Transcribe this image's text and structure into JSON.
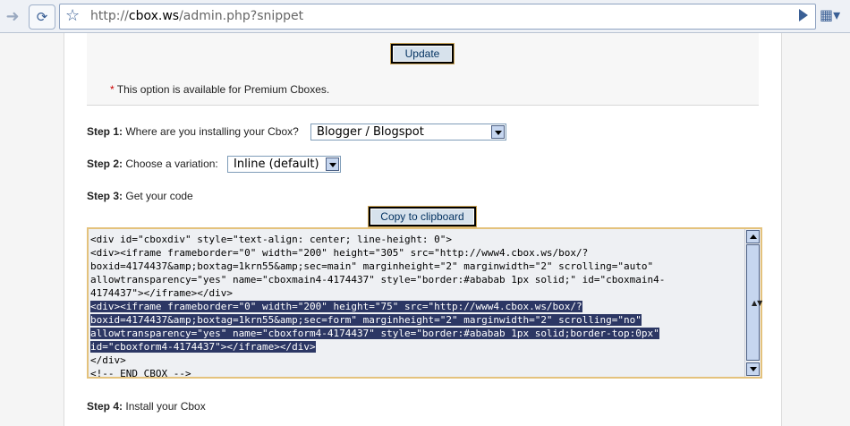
{
  "browser": {
    "back_icon": "arrow-right-icon",
    "reload_icon": "refresh-icon",
    "bookmark_icon": "star-icon",
    "url_prefix": "http://",
    "url_host": "cbox.ws",
    "url_path": "/admin.php?snippet",
    "page_icon": "page-icon"
  },
  "options": {
    "update_label": "Update",
    "premium_marker": "*",
    "premium_note": "This option is available for Premium Cboxes."
  },
  "steps": {
    "step1_label": "Step 1:",
    "step1_text": "Where are you installing your Cbox?",
    "step1_value": "Blogger / Blogspot",
    "step2_label": "Step 2:",
    "step2_text": "Choose a variation:",
    "step2_value": "Inline (default)",
    "step3_label": "Step 3:",
    "step3_text": "Get your code",
    "copy_label": "Copy to clipboard",
    "step4_label": "Step 4:",
    "step4_text": "Install your Cbox"
  },
  "code_lines": [
    "<div id=\"cboxdiv\" style=\"text-align: center; line-height: 0\">",
    "<div><iframe frameborder=\"0\" width=\"200\" height=\"305\" src=\"http://www4.cbox.ws/box/?",
    "boxid=4174437&amp;boxtag=1krn55&amp;sec=main\" marginheight=\"2\" marginwidth=\"2\" scrolling=\"auto\"",
    "allowtransparency=\"yes\" name=\"cboxmain4-4174437\" style=\"border:#ababab 1px solid;\" id=\"cboxmain4-",
    "4174437\"></iframe></div>",
    "<div><iframe frameborder=\"0\" width=\"200\" height=\"75\" src=\"http://www4.cbox.ws/box/?",
    "boxid=4174437&amp;boxtag=1krn55&amp;sec=form\" marginheight=\"2\" marginwidth=\"2\" scrolling=\"no\"",
    "allowtransparency=\"yes\" name=\"cboxform4-4174437\" style=\"border:#ababab 1px solid;border-top:0px\"",
    "id=\"cboxform4-4174437\"></iframe></div>",
    "</div>",
    "<!-- END CBOX -->"
  ],
  "selected_lines": [
    5,
    6,
    7,
    8
  ],
  "colors": {
    "selection": "#2c3764",
    "button_bg": "#d7e2ec",
    "textarea_border": "#e4c27c"
  }
}
